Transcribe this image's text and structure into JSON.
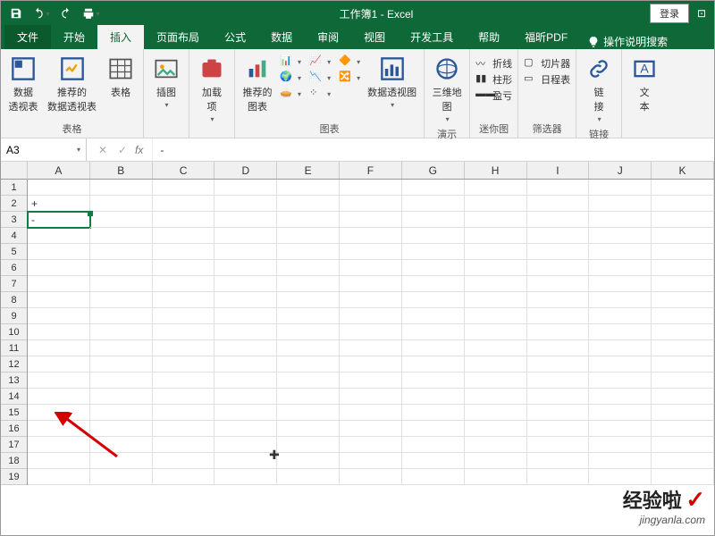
{
  "titlebar": {
    "title": "工作簿1 - Excel",
    "login": "登录"
  },
  "tabs": {
    "file": "文件",
    "home": "开始",
    "insert": "插入",
    "pagelayout": "页面布局",
    "formulas": "公式",
    "data": "数据",
    "review": "审阅",
    "view": "视图",
    "developer": "开发工具",
    "help": "帮助",
    "foxit": "福昕PDF",
    "tellme": "操作说明搜索"
  },
  "ribbon": {
    "pivot_table": "数据\n透视表",
    "recommended_pivot": "推荐的\n数据透视表",
    "table": "表格",
    "group_tables": "表格",
    "illustrations": "插图",
    "addins": "加载\n项",
    "recommended_charts": "推荐的\n图表",
    "group_charts": "图表",
    "pivot_chart": "数据透视图",
    "map3d": "三维地\n图",
    "group_tours": "演示",
    "sparkline_line": "折线",
    "sparkline_column": "柱形",
    "sparkline_winloss": "盈亏",
    "group_sparklines": "迷你图",
    "slicer": "切片器",
    "timeline": "日程表",
    "group_filters": "筛选器",
    "link": "链\n接",
    "group_links": "链接",
    "textbox": "文\n本"
  },
  "formula_bar": {
    "name_box": "A3",
    "formula": "-"
  },
  "columns": [
    "A",
    "B",
    "C",
    "D",
    "E",
    "F",
    "G",
    "H",
    "I",
    "J",
    "K"
  ],
  "rows_count": 19,
  "cells": {
    "A2": "+",
    "A3": "-"
  },
  "selection": "A3",
  "watermark": {
    "brand": "经验啦",
    "url": "jingyanla.com"
  }
}
